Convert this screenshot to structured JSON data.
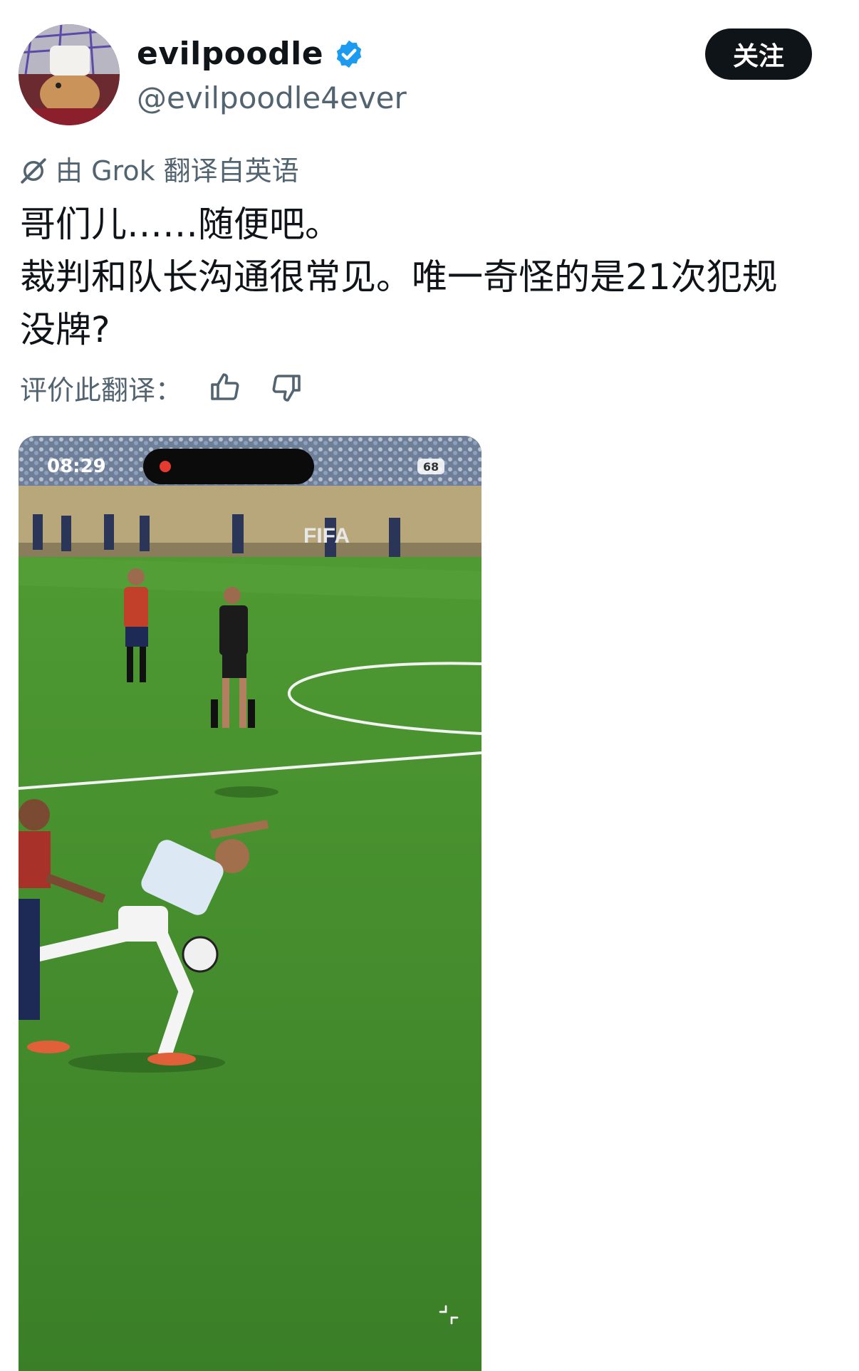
{
  "user": {
    "display_name": "evilpoodle",
    "handle": "@evilpoodle4ever",
    "verified": true,
    "avatar_icon": "hamster-avatar"
  },
  "follow_button": "关注",
  "translation": {
    "note": "由 Grok 翻译自英语",
    "icon": "grok-icon"
  },
  "tweet": {
    "lines": [
      "哥们儿……随便吧。",
      "裁判和队长沟通很常见。唯一奇怪的是21次犯规",
      "没牌?"
    ]
  },
  "rating": {
    "label": "评价此翻译：",
    "like_icon": "thumbs-up-icon",
    "dislike_icon": "thumbs-down-icon"
  },
  "media": {
    "status_time": "08:29",
    "battery": "68",
    "stadium_sign": "FIFA"
  },
  "colors": {
    "verified_blue": "#1d9bf0",
    "follow_bg": "#0f1419",
    "muted_text": "#536471",
    "pitch_green": "#3f8a2c"
  }
}
